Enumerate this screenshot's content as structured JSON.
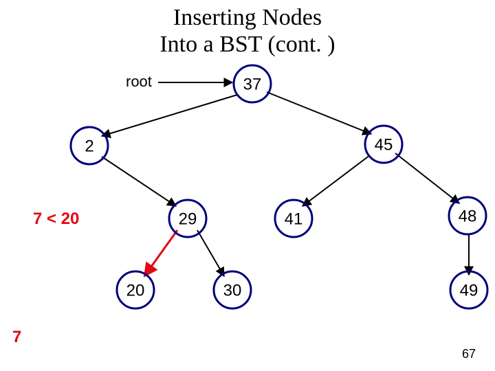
{
  "title_line1": "Inserting Nodes",
  "title_line2": "Into a BST (cont. )",
  "root_label": "root",
  "comparison_label": "7 < 20",
  "insert_value": "7",
  "page_number": "67",
  "nodes": {
    "n37": "37",
    "n2": "2",
    "n45": "45",
    "n29": "29",
    "n41": "41",
    "n48": "48",
    "n20": "20",
    "n30": "30",
    "n49": "49"
  },
  "chart_data": {
    "type": "tree",
    "title": "Binary Search Tree insertion walkthrough",
    "root": 37,
    "edges": [
      {
        "from": 37,
        "to": 2,
        "side": "left"
      },
      {
        "from": 37,
        "to": 45,
        "side": "right"
      },
      {
        "from": 2,
        "to": 29,
        "side": "right"
      },
      {
        "from": 45,
        "to": 41,
        "side": "left"
      },
      {
        "from": 45,
        "to": 48,
        "side": "right"
      },
      {
        "from": 29,
        "to": 20,
        "side": "left"
      },
      {
        "from": 29,
        "to": 30,
        "side": "right"
      },
      {
        "from": 48,
        "to": 49,
        "side": "right"
      }
    ],
    "highlight_path_edge": {
      "from": 29,
      "to": 20
    },
    "current_comparison": "7 < 20",
    "value_to_insert": 7
  }
}
